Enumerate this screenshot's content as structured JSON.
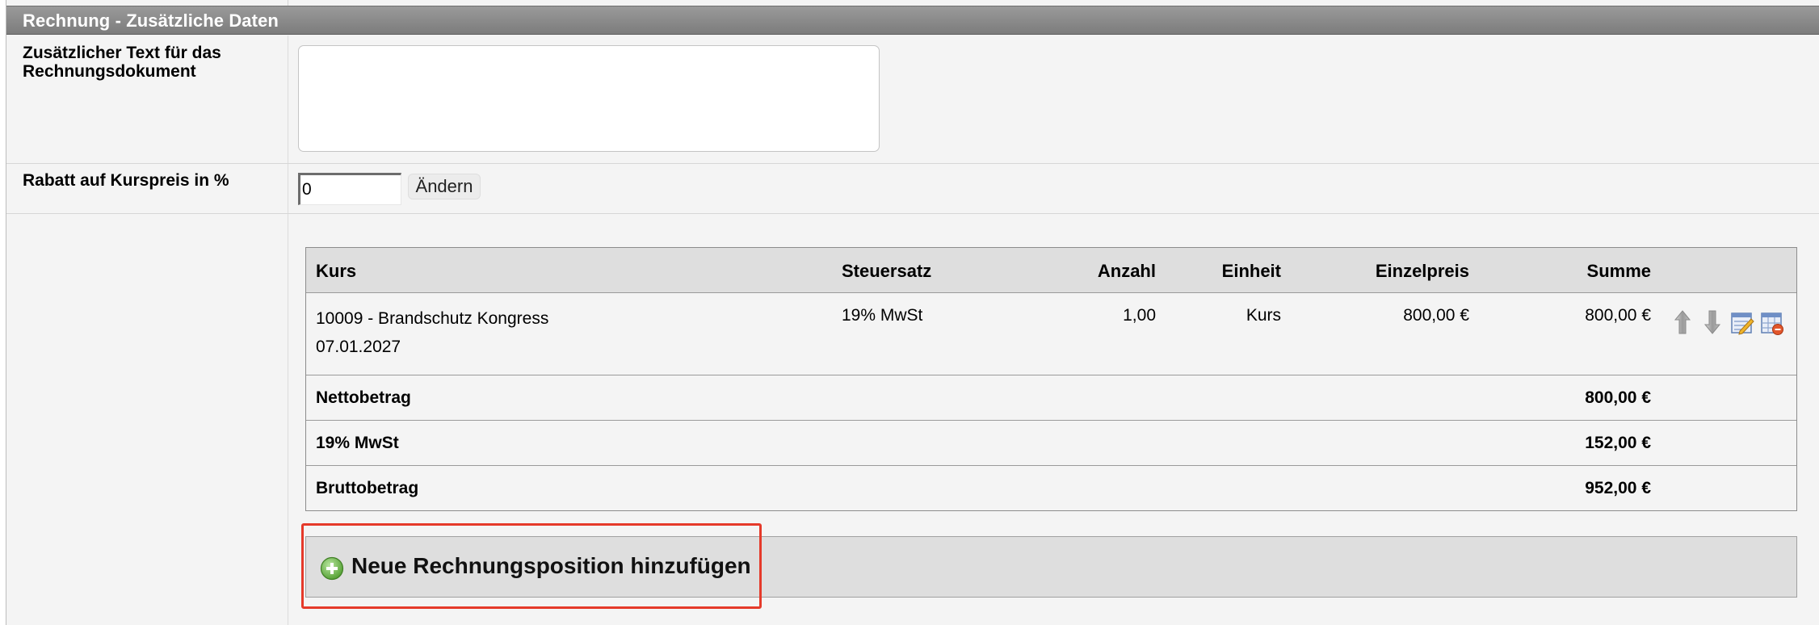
{
  "section": {
    "title": "Rechnung - Zusätzliche Daten"
  },
  "extra_text": {
    "label_line1": "Zusätzlicher Text für das",
    "label_line2": "Rechnungsdokument",
    "value": ""
  },
  "discount": {
    "label": "Rabatt auf Kurspreis in %",
    "value": "0",
    "button_label": "Ändern"
  },
  "table": {
    "headers": {
      "kurs": "Kurs",
      "steuersatz": "Steuersatz",
      "anzahl": "Anzahl",
      "einheit": "Einheit",
      "einzelpreis": "Einzelpreis",
      "summe": "Summe"
    },
    "rows": [
      {
        "course": "10009 - Brandschutz Kongress",
        "date": "07.01.2027",
        "tax": "19% MwSt",
        "quantity": "1,00",
        "unit": "Kurs",
        "unit_price": "800,00 €",
        "total": "800,00 €",
        "actions": [
          "arrow-up-icon",
          "arrow-down-icon",
          "edit-icon",
          "delete-icon"
        ]
      }
    ],
    "totals": {
      "net_label": "Nettobetrag",
      "net_value": "800,00 €",
      "tax_label": "19% MwSt",
      "tax_value": "152,00 €",
      "gross_label": "Bruttobetrag",
      "gross_value": "952,00 €"
    }
  },
  "add_position": {
    "label": "Neue Rechnungsposition hinzufügen",
    "icon": "plus-circle-icon"
  },
  "colors": {
    "header_bg": "#8a8a8a",
    "highlight": "#e53a2a",
    "add_icon": "#5fae3c"
  }
}
